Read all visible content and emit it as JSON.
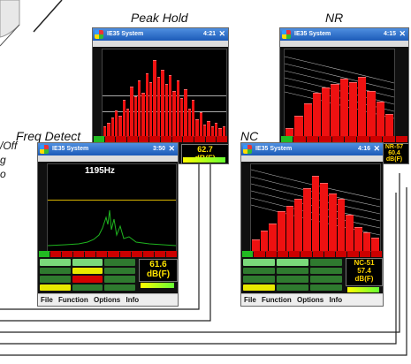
{
  "captions": {
    "peak_hold": "Peak Hold",
    "nr": "NR",
    "freq_detect": "Freq Detect",
    "nc": "NC"
  },
  "side_text": {
    "line1": "/Off",
    "line2": "g",
    "line3": "o"
  },
  "app": {
    "title": "IE35 System"
  },
  "screens": {
    "peak_hold": {
      "time": "4:21",
      "readout": "62.7",
      "unit": "dB(F)"
    },
    "nr": {
      "time": "4:15",
      "label": "NR-57",
      "value": "60.4",
      "unit": "dB(F)"
    },
    "freq_detect": {
      "time": "3:50",
      "frequency": "1195Hz",
      "readout": "61.6",
      "unit": "dB(F)"
    },
    "nc": {
      "time": "4:16",
      "label": "NC-51",
      "value": "57.4",
      "unit": "dB(F)"
    }
  },
  "menu": {
    "file": "File",
    "function": "Function",
    "options": "Options",
    "info": "Info"
  },
  "colors": {
    "bar": "#ee1111",
    "titlebar": "#1c5bb8",
    "readout": "#ffe400"
  }
}
